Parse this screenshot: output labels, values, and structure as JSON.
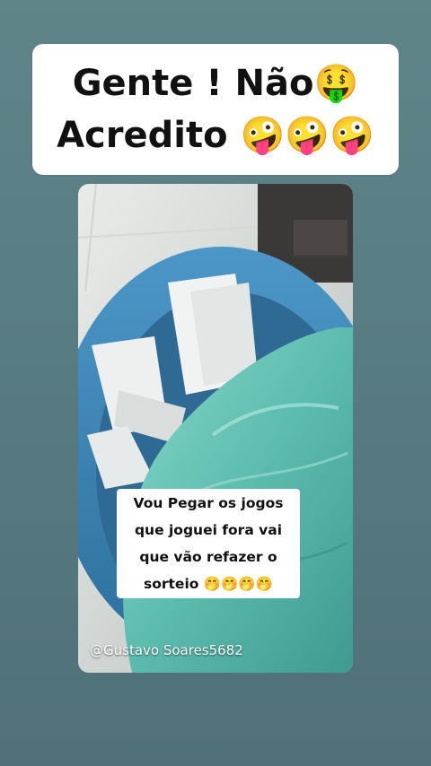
{
  "title": {
    "line1": "Gente ! Não🤑",
    "line2": "Acredito 🤪🤪🤪"
  },
  "caption": {
    "text": "Vou Pegar os jogos que joguei fora vai que vão refazer o sorteio 🤭🤭🤭🤭"
  },
  "watermark": "@Gustavo Soares5682",
  "colors": {
    "background": "#577c82",
    "card": "#ffffff",
    "bin_blue": "#3f86b8",
    "bag_teal": "#6fc8ba"
  }
}
